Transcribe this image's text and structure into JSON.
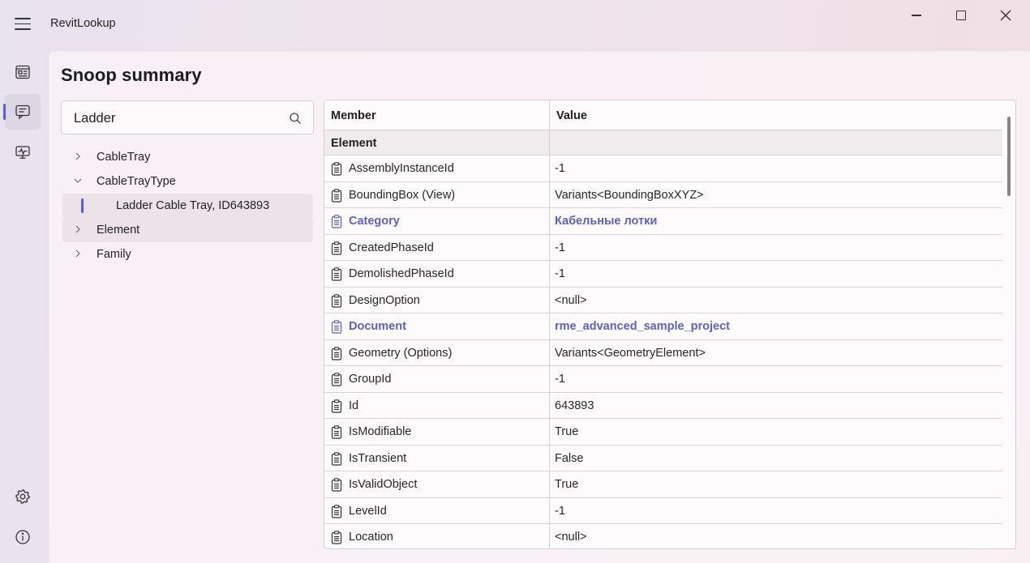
{
  "app": {
    "title": "RevitLookup"
  },
  "window_controls": {
    "minimize_icon": "minimize-icon",
    "maximize_icon": "maximize-icon",
    "close_icon": "close-icon"
  },
  "nav": {
    "items": [
      {
        "name": "dashboard",
        "icon": "dashboard-icon"
      },
      {
        "name": "snoop-summary",
        "icon": "snoop-icon",
        "active": true
      },
      {
        "name": "events",
        "icon": "monitor-icon"
      },
      {
        "name": "settings",
        "icon": "gear-icon"
      },
      {
        "name": "about",
        "icon": "info-icon"
      }
    ]
  },
  "page": {
    "title": "Snoop summary"
  },
  "search": {
    "value": "Ladder"
  },
  "tree": {
    "items": [
      {
        "label": "CableTray",
        "expanded": false
      },
      {
        "label": "CableTrayType",
        "expanded": true
      },
      {
        "label": "Ladder Cable Tray, ID643893",
        "selected": true
      },
      {
        "label": "Element",
        "expanded": false
      },
      {
        "label": "Family",
        "expanded": false
      }
    ]
  },
  "grid": {
    "columns": {
      "member": "Member",
      "value": "Value"
    },
    "group": "Element",
    "rows": [
      {
        "member": "AssemblyInstanceId",
        "value": "-1"
      },
      {
        "member": "BoundingBox (View)",
        "value": "Variants<BoundingBoxXYZ>"
      },
      {
        "member": "Category",
        "value": "Кабельные лотки",
        "link": true
      },
      {
        "member": "CreatedPhaseId",
        "value": "-1"
      },
      {
        "member": "DemolishedPhaseId",
        "value": "-1"
      },
      {
        "member": "DesignOption",
        "value": "<null>"
      },
      {
        "member": "Document",
        "value": "rme_advanced_sample_project",
        "link": true
      },
      {
        "member": "Geometry (Options)",
        "value": "Variants<GeometryElement>"
      },
      {
        "member": "GroupId",
        "value": "-1"
      },
      {
        "member": "Id",
        "value": "643893"
      },
      {
        "member": "IsModifiable",
        "value": "True"
      },
      {
        "member": "IsTransient",
        "value": "False"
      },
      {
        "member": "IsValidObject",
        "value": "True"
      },
      {
        "member": "LevelId",
        "value": "-1"
      },
      {
        "member": "Location",
        "value": "<null>"
      }
    ]
  },
  "colors": {
    "accent": "#5b5fc7",
    "link": "#5c5fc4"
  }
}
